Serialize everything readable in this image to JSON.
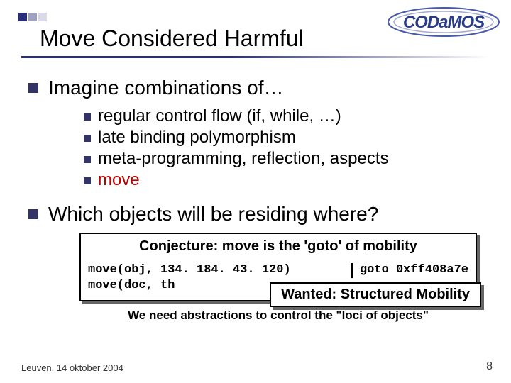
{
  "header": {
    "title": "Move Considered Harmful",
    "logo_text": "CODaMOS"
  },
  "content": {
    "main1": "Imagine combinations of…",
    "subs": [
      "regular control flow (if, while, …)",
      "late binding polymorphism",
      "meta-programming, reflection, aspects",
      "move"
    ],
    "main2": "Which objects will be residing where?"
  },
  "box": {
    "conjecture": "Conjecture: move is the 'goto' of mobility",
    "code_left1": "move(obj, 134. 184. 43. 120)",
    "code_right1": "goto 0xff408a7e",
    "code_left2": "move(doc, th",
    "wanted": "Wanted: Structured Mobility",
    "need": "We need abstractions to control the \"loci of objects\""
  },
  "footer": {
    "location": "Leuven, 14 oktober 2004",
    "page": "8"
  }
}
